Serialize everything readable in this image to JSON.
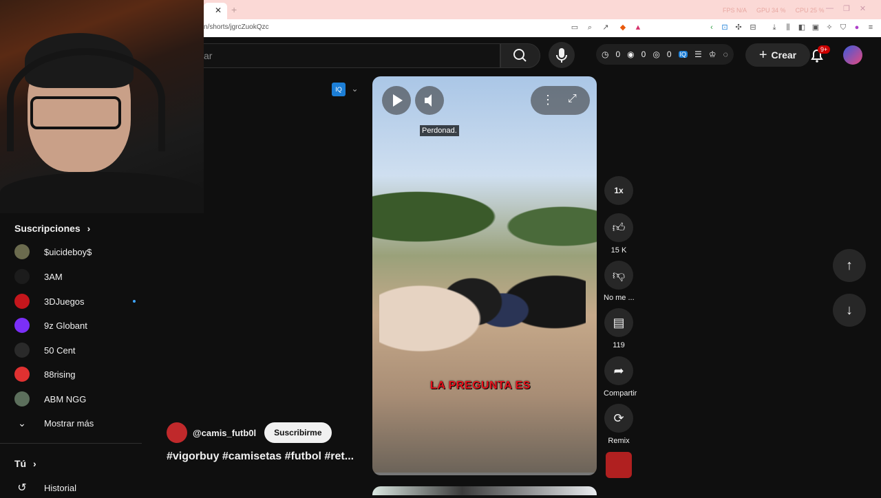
{
  "browser": {
    "url": "n/shorts/jgrcZuokQzc",
    "stats": [
      "FPS N/A",
      "GPU 34 %",
      "CPU 25 %"
    ]
  },
  "header": {
    "search_placeholder": "ar",
    "counters": [
      "0",
      "0",
      "0"
    ],
    "create_label": "Crear",
    "notifications_badge": "9+"
  },
  "sidebar": {
    "subscriptions_title": "Suscripciones",
    "subscriptions": [
      {
        "name": "$uicideboy$",
        "color": "#6b6b4e"
      },
      {
        "name": "3AM",
        "color": "#1c1c1c"
      },
      {
        "name": "3DJuegos",
        "color": "#c4161c"
      },
      {
        "name": "9z Globant",
        "color": "#7b2ff7"
      },
      {
        "name": "50 Cent",
        "color": "#2a2a2a"
      },
      {
        "name": "88rising",
        "color": "#e03131"
      },
      {
        "name": "ABM NGG",
        "color": "#5c6f5c"
      }
    ],
    "show_more": "Mostrar más",
    "you_title": "Tú",
    "history": "Historial"
  },
  "short": {
    "caption": "Perdonad.",
    "subtitle": "LA PREGUNTA ES",
    "speed": "1x",
    "likes": "15 K",
    "dislike_label": "No me ...",
    "comments": "119",
    "share_label": "Compartir",
    "remix_label": "Remix",
    "channel": "@camis_futb0l",
    "subscribe_label": "Suscribirme",
    "hashtags": "#vigorbuy #camisetas #futbol #ret..."
  },
  "colors": {
    "background": "#0f0f0f",
    "accent_red": "#cc0000",
    "subtitle_red": "#e8121c",
    "unread_dot": "#3ea6ff"
  }
}
